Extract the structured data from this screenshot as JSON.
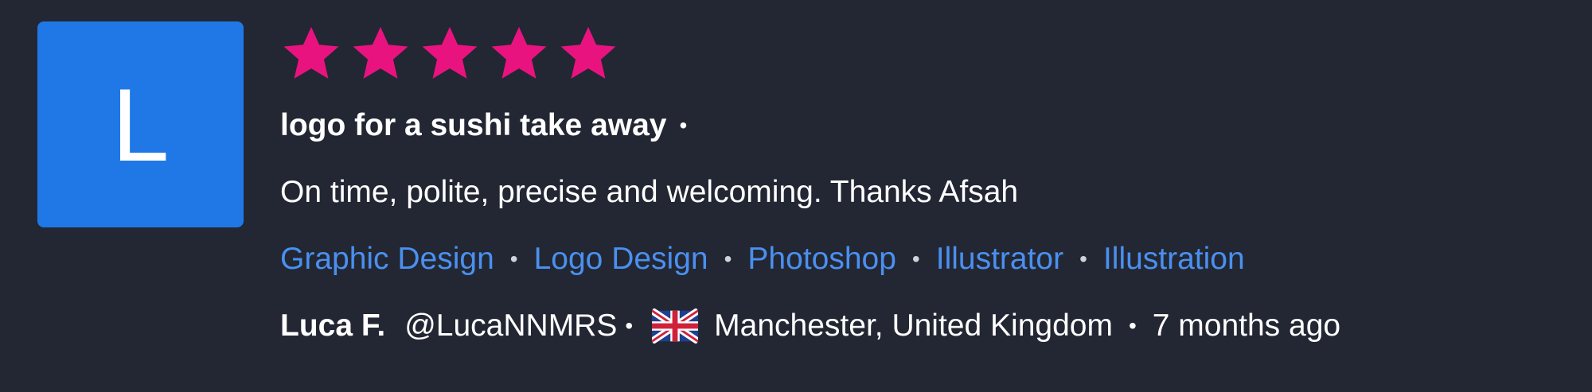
{
  "avatar": {
    "initial": "L",
    "color": "#1f78e6"
  },
  "rating": {
    "value": 5,
    "max": 5,
    "color": "#e9137f"
  },
  "review": {
    "title": "logo for a sushi take away",
    "separator": "•",
    "text": "On time, polite, precise and welcoming. Thanks Afsah"
  },
  "tags": {
    "items": [
      "Graphic Design",
      "Logo Design",
      "Photoshop",
      "Illustrator",
      "Illustration"
    ],
    "separator": "•",
    "color": "#4a90f0"
  },
  "reviewer": {
    "name": "Luca F.",
    "handle": "@LucaNNMRS",
    "separator": "•",
    "flag_icon": "uk-flag-icon",
    "location": "Manchester, United Kingdom",
    "time_separator": "•",
    "time_ago": "7 months ago"
  }
}
